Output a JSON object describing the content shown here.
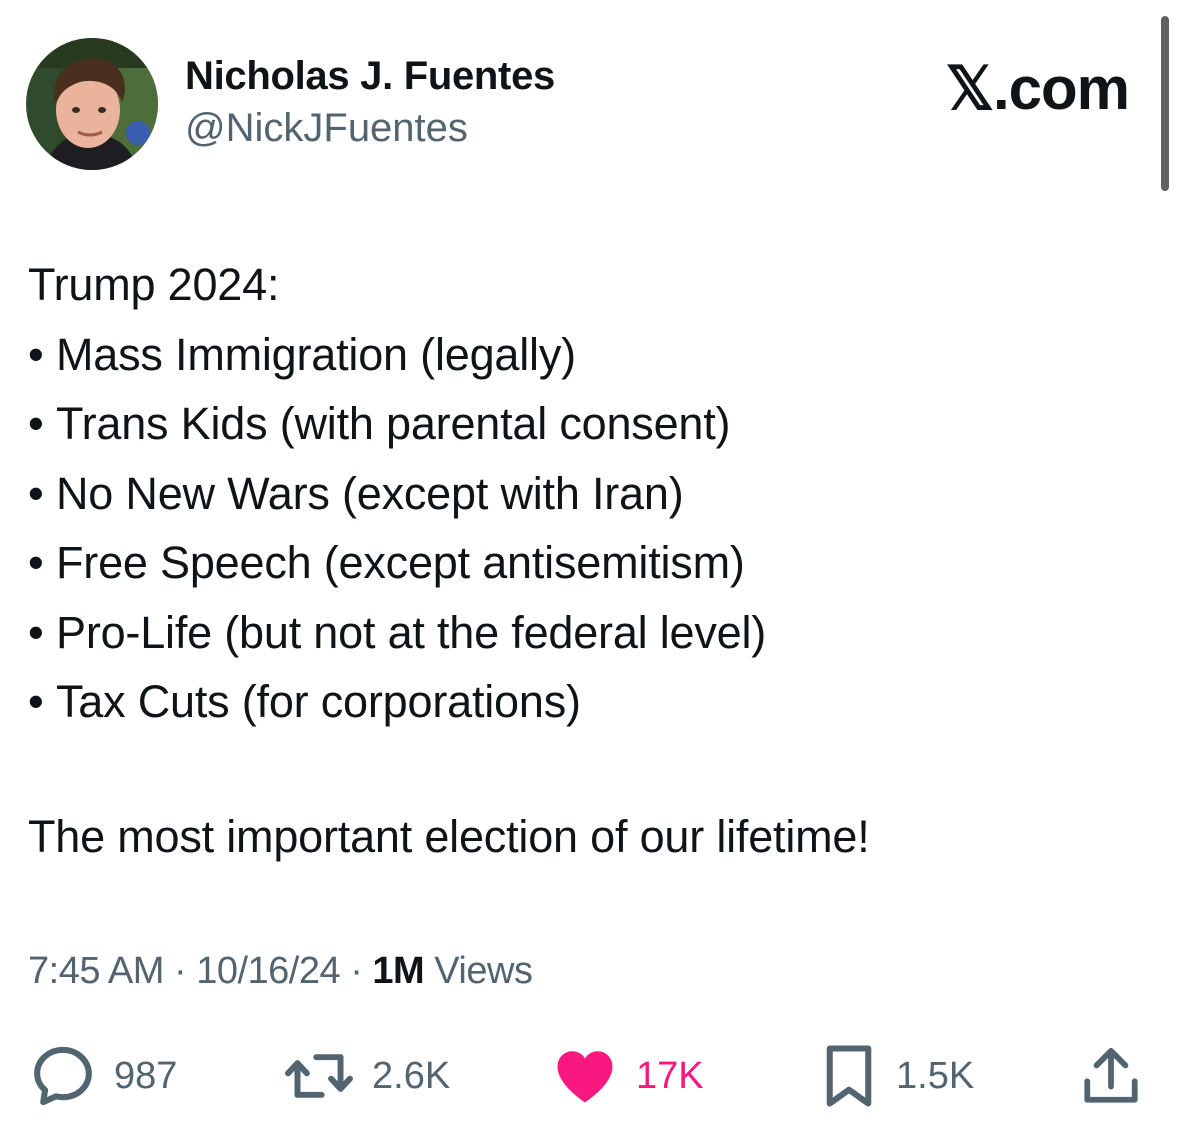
{
  "author": {
    "display_name": "Nicholas J. Fuentes",
    "handle": "@NickJFuentes",
    "avatar_icon": "profile-photo"
  },
  "brand": {
    "label": "𝕏.com"
  },
  "tweet": {
    "heading": "Trump 2024:",
    "bullet_symbol": "•",
    "bullets": [
      "Mass Immigration (legally)",
      "Trans Kids (with parental consent)",
      "No New Wars (except with Iran)",
      "Free Speech (except antisemitism)",
      "Pro-Life (but not at the federal level)",
      "Tax Cuts (for corporations)"
    ],
    "closing": "The most important election of our lifetime!"
  },
  "meta": {
    "time": "7:45 AM",
    "separator": "·",
    "date": "10/16/24",
    "views_count": "1M",
    "views_label": "Views"
  },
  "actions": {
    "replies": {
      "icon": "reply-icon",
      "count": "987"
    },
    "reposts": {
      "icon": "repost-icon",
      "count": "2.6K"
    },
    "likes": {
      "icon": "heart-icon",
      "count": "17K",
      "color": "#f91880"
    },
    "bookmarks": {
      "icon": "bookmark-icon",
      "count": "1.5K"
    },
    "share": {
      "icon": "share-icon"
    }
  },
  "colors": {
    "text": "#0f1419",
    "secondary": "#536471",
    "like": "#f91880"
  }
}
